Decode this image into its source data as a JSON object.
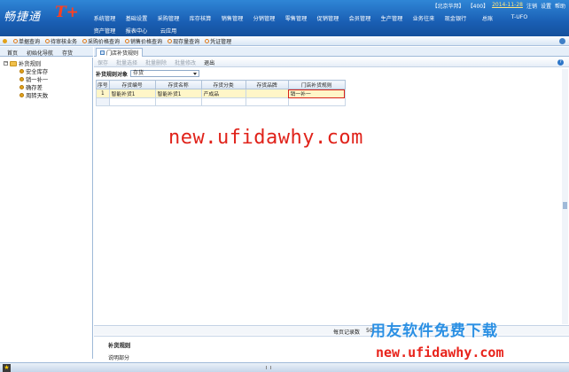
{
  "app": {
    "logo_text": "畅捷通",
    "logo_suffix": "T+"
  },
  "topinfo": {
    "company": "【北京华邦】",
    "account": "【400】",
    "date": "2014-11-28",
    "logout": "注销",
    "settings": "设置",
    "help": "帮助"
  },
  "menu": {
    "row1": [
      "系统管理",
      "基础设置",
      "采购管理",
      "库存核算",
      "销售管理",
      "分销管理",
      "零售管理",
      "促销管理",
      "会员管理",
      "生产管理",
      "业务往来",
      "现金银行",
      "总账",
      "T-UFO"
    ],
    "row2": [
      "资产管理",
      "报表中心",
      "云应用"
    ]
  },
  "quickbar": [
    "单据查询",
    "待审核业务",
    "采购价格查询",
    "销售价格查询",
    "现存量查询",
    "凭证管理"
  ],
  "navtabs": [
    "首页",
    "初始化导航",
    "存货"
  ],
  "tree": {
    "root": "补货规则",
    "items": [
      "安全库存",
      "销一补一",
      "确存差",
      "周转天数"
    ]
  },
  "content_tab": "门店补货规则",
  "actions": [
    {
      "label": "保存",
      "enabled": false
    },
    {
      "label": "批量选择",
      "enabled": false
    },
    {
      "label": "批量删除",
      "enabled": false
    },
    {
      "label": "批量修改",
      "enabled": false
    },
    {
      "label": "退出",
      "enabled": true
    }
  ],
  "filter": {
    "label": "补货规则对象",
    "value": "存货"
  },
  "table": {
    "headers": [
      "序号",
      "存货编号",
      "存货名称",
      "存货分类",
      "存货品牌",
      "门店补货规则"
    ],
    "rows": [
      [
        "1",
        "智能补货1",
        "智能补货1",
        "产成品",
        "",
        "销一补一"
      ],
      [
        "",
        "",
        "",
        "",
        "",
        ""
      ]
    ]
  },
  "watermark": "new.ufidawhy.com",
  "pager": {
    "label": "每页记录数",
    "count": "50"
  },
  "desc": {
    "title": "补货规则",
    "text": "说明部分"
  },
  "promo": {
    "line1": "用友软件免费下载",
    "line2": "new.ufidawhy.com"
  }
}
